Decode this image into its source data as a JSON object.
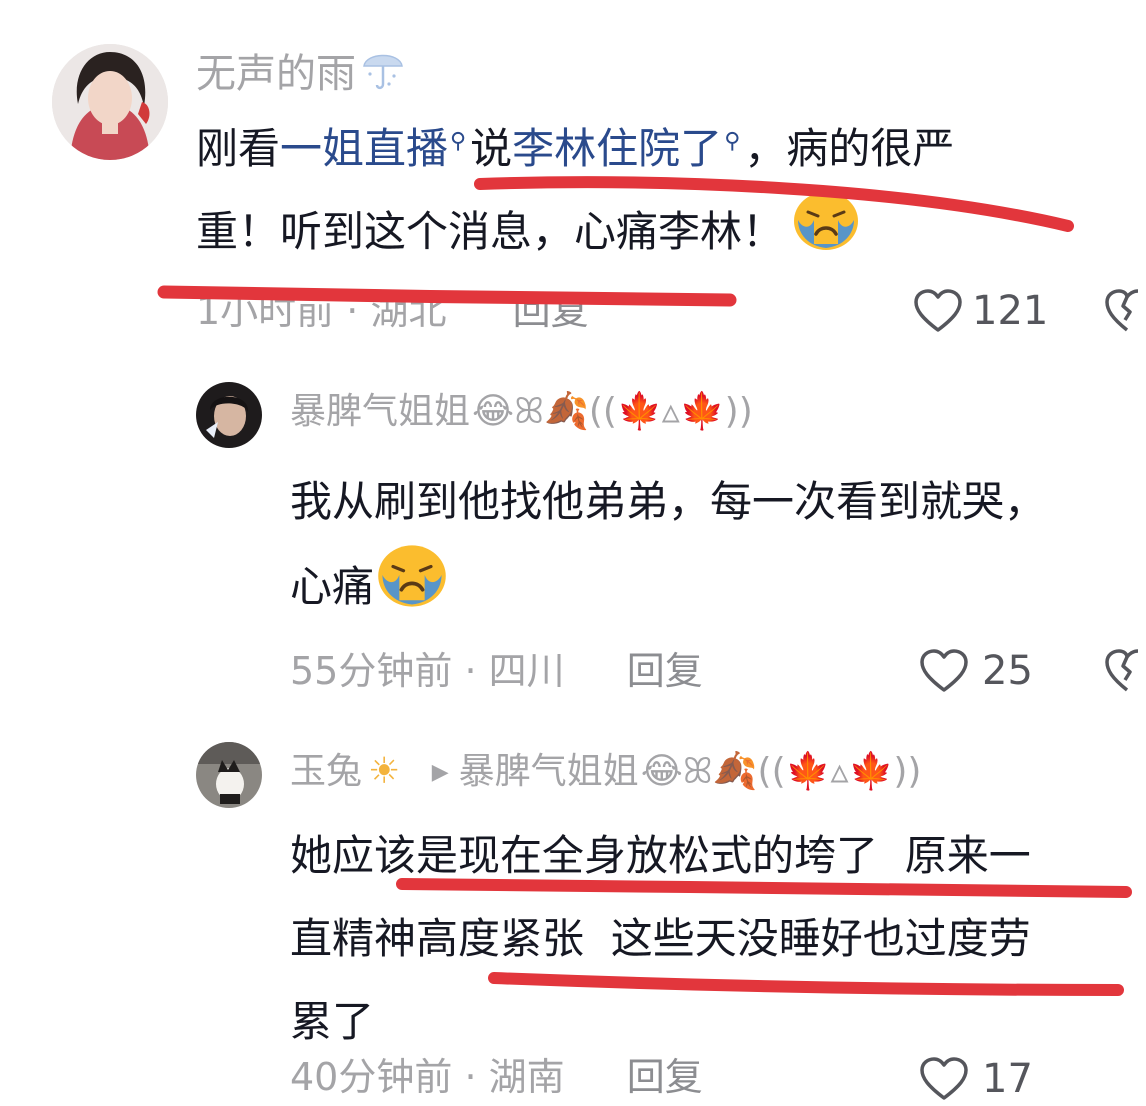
{
  "comments": [
    {
      "username": "无声的雨",
      "username_icon": "umbrella-rain-icon",
      "text_pre": "刚看",
      "link1": "一姐直播",
      "text_mid": "说",
      "link2": "李林住院了",
      "text_post1": "，病的很严",
      "text_line2": "重！听到这个消息，心痛李林！",
      "emoji": "crying-face",
      "time": "1小时前",
      "location": "湖北",
      "reply_label": "回复",
      "likes": "121"
    },
    {
      "username": "暴脾气姐姐",
      "username_decor": "😂ꕤ🍂((🍁▵🍁))",
      "text_line1": "我从刷到他找他弟弟，每一次看到就哭，",
      "text_line2": "心痛",
      "emoji": "crying-face",
      "time": "55分钟前",
      "location": "四川",
      "reply_label": "回复",
      "likes": "25"
    },
    {
      "username": "玉兔",
      "username_icon": "sun-icon",
      "reply_to": "暴脾气姐姐",
      "reply_to_decor": "😂ꕤ🍂((🍁▵🍁))",
      "text_line1": "她应该是现在全身放松式的垮了  原来一",
      "text_line2": "直精神高度紧张  这些天没睡好也过度劳",
      "text_line3": "累了",
      "time": "40分钟前",
      "location": "湖南",
      "reply_label": "回复",
      "likes": "17"
    }
  ],
  "colors": {
    "text": "#161823",
    "muted": "#a4a4a7",
    "link": "#2a4a8c",
    "annotation": "#e2363c"
  }
}
